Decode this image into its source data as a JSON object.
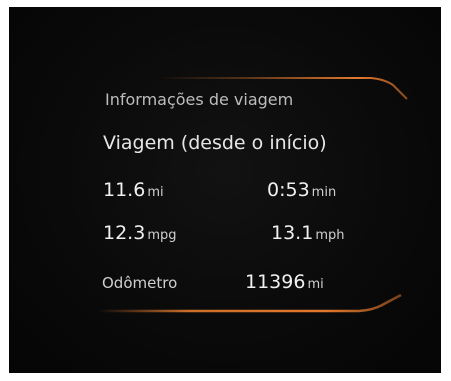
{
  "panel": {
    "title": "Informações de viagem",
    "subtitle": "Viagem (desde o início)"
  },
  "stats": {
    "distance": {
      "value": "11.6",
      "unit": "mi"
    },
    "time": {
      "value": "0:53",
      "unit": "min"
    },
    "economy": {
      "value": "12.3",
      "unit": "mpg"
    },
    "speed": {
      "value": "13.1",
      "unit": "mph"
    }
  },
  "odometer": {
    "label": "Odômetro",
    "value": "11396",
    "unit": "mi"
  },
  "colors": {
    "accent": "#e2792d",
    "background": "#0b0b0b",
    "divider": "#5a5a5a"
  }
}
